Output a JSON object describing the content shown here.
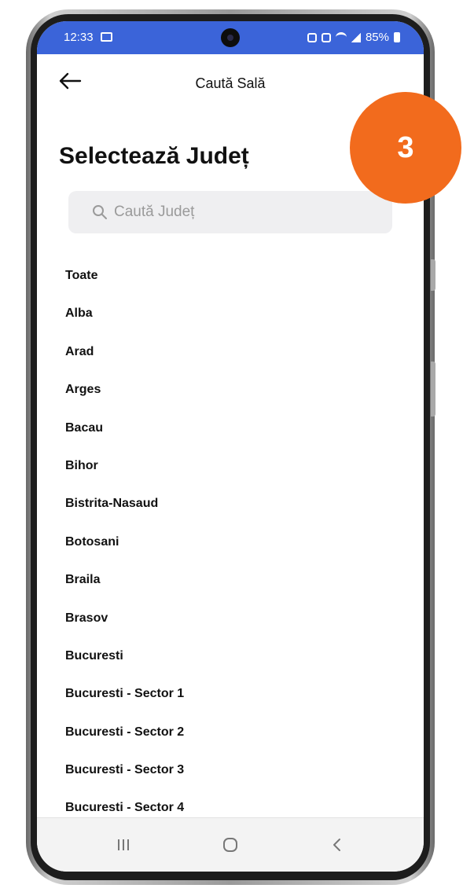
{
  "status_bar": {
    "time": "12:33",
    "battery": "85%"
  },
  "header": {
    "title": "Caută Sală"
  },
  "page_title": "Selectează Județ",
  "search": {
    "placeholder": "Caută Județ",
    "value": ""
  },
  "counties": [
    "Toate",
    "Alba",
    "Arad",
    "Arges",
    "Bacau",
    "Bihor",
    "Bistrita-Nasaud",
    "Botosani",
    "Braila",
    "Brasov",
    "Bucuresti",
    "Bucuresti - Sector 1",
    "Bucuresti - Sector 2",
    "Bucuresti - Sector 3",
    "Bucuresti - Sector 4"
  ],
  "step_badge": {
    "number": "3"
  },
  "colors": {
    "status_bar": "#3b64d9",
    "badge": "#f26b1d",
    "search_bg": "#efeff1"
  },
  "icons": {
    "back": "arrow-left-icon",
    "search": "magnifier-icon",
    "nav": [
      "recents-icon",
      "home-icon",
      "back-chevron-icon"
    ]
  }
}
